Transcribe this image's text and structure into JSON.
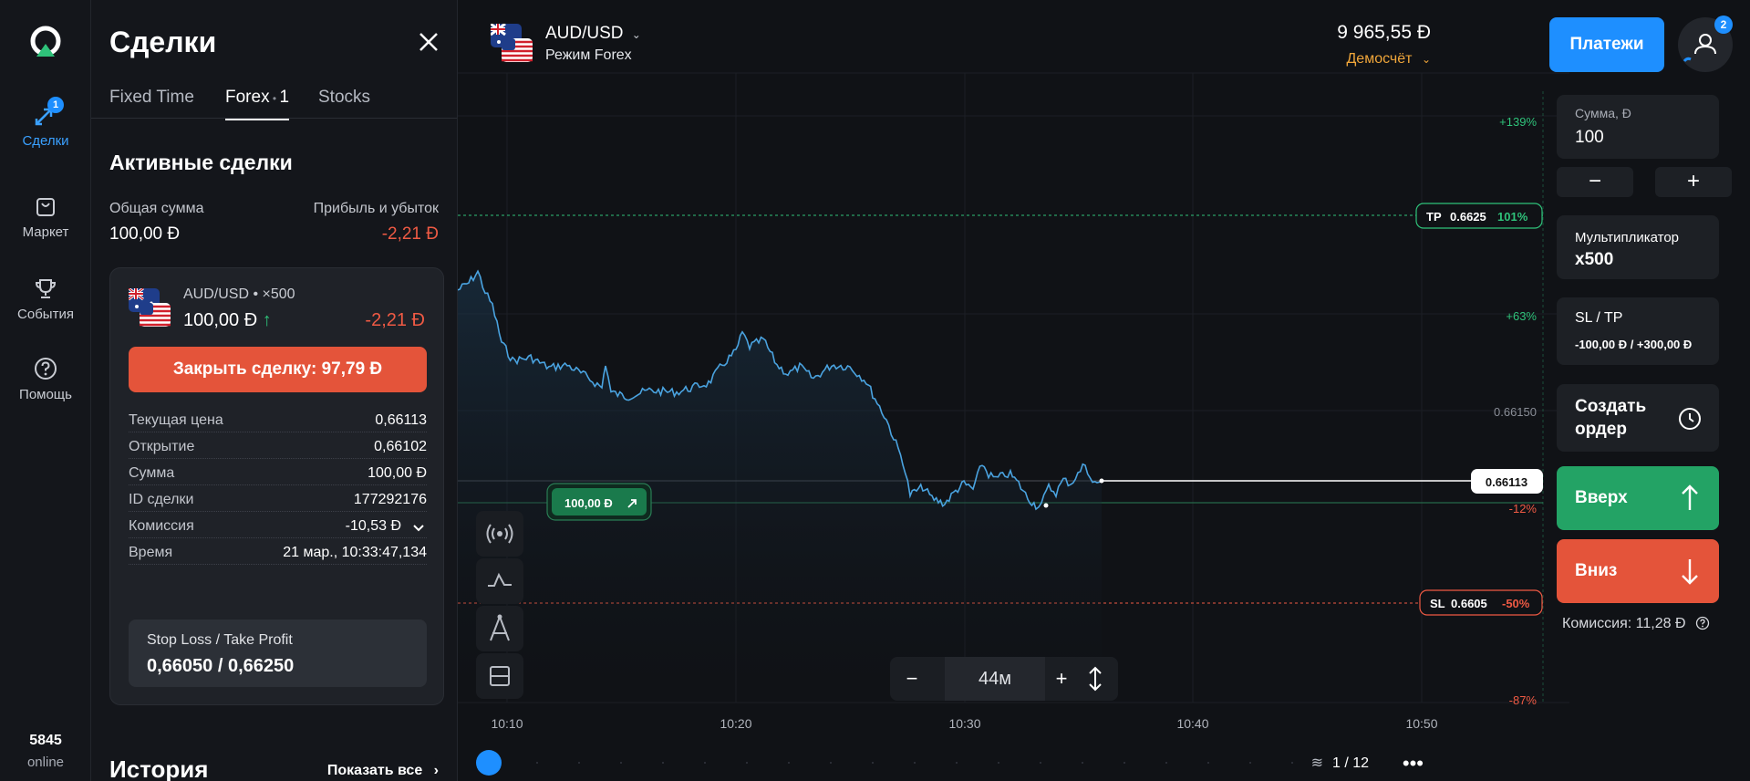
{
  "rail": {
    "items": [
      {
        "label": "Сделки",
        "badge": "1"
      },
      {
        "label": "Маркет"
      },
      {
        "label": "События"
      },
      {
        "label": "Помощь"
      }
    ],
    "online_count": "5845",
    "online_label": "online"
  },
  "panel": {
    "title": "Сделки",
    "tabs": [
      {
        "label": "Fixed Time"
      },
      {
        "label": "Forex",
        "count": "1"
      },
      {
        "label": "Stocks"
      }
    ],
    "section_title": "Активные сделки",
    "total_label": "Общая сумма",
    "total_value": "100,00 Đ",
    "pl_label": "Прибыль и убыток",
    "pl_value": "-2,21 Đ",
    "trade": {
      "pair": "AUD/USD • ×500",
      "amount": "100,00 Đ",
      "pl": "-2,21 Đ",
      "close_label": "Закрыть сделку: 97,79 Đ",
      "rows": [
        {
          "k": "Текущая цена",
          "v": "0,66113"
        },
        {
          "k": "Открытие",
          "v": "0,66102"
        },
        {
          "k": "Сумма",
          "v": "100,00 Đ"
        },
        {
          "k": "ID сделки",
          "v": "177292176"
        },
        {
          "k": "Комиссия",
          "v": "-10,53 Đ"
        },
        {
          "k": "Время",
          "v": "21 мар., 10:33:47,134"
        }
      ],
      "sltp_label": "Stop Loss / Take Profit",
      "sltp_value": "0,66050 / 0,66250"
    },
    "history_title": "История",
    "show_all": "Показать все"
  },
  "header": {
    "asset": "AUD/USD",
    "mode": "Режим Forex",
    "balance": "9 965,55 Đ",
    "account": "Демосчёт"
  },
  "chart": {
    "y_labels": [
      "+139%",
      "+63%",
      "0.66150",
      "-12%",
      "-87%"
    ],
    "x_labels": [
      "10:10",
      "10:20",
      "10:30",
      "10:40",
      "10:50"
    ],
    "tp_label": "TP",
    "tp_price": "0.6625",
    "tp_pct": "101%",
    "sl_label": "SL",
    "sl_price": "0.6605",
    "sl_pct": "-50%",
    "current_price": "0.66113",
    "position_tag": "100,00 Đ",
    "zoom": "44м",
    "pager": "1 / 12",
    "colors": {
      "line": "#4aa3e0",
      "tp": "#2fc27a",
      "sl": "#ef5a44"
    }
  },
  "right": {
    "payments": "Платежи",
    "avatar_badge": "2",
    "amount_label": "Сумма, Đ",
    "amount_value": "100",
    "multiplier_label": "Мультипликатор",
    "multiplier_value": "x500",
    "sltp_label": "SL / TP",
    "sltp_value": "-100,00 Đ / +300,00 Đ",
    "create_order": "Создать ордер",
    "up": "Вверх",
    "down": "Вниз",
    "commission": "Комиссия: 11,28 Đ"
  }
}
